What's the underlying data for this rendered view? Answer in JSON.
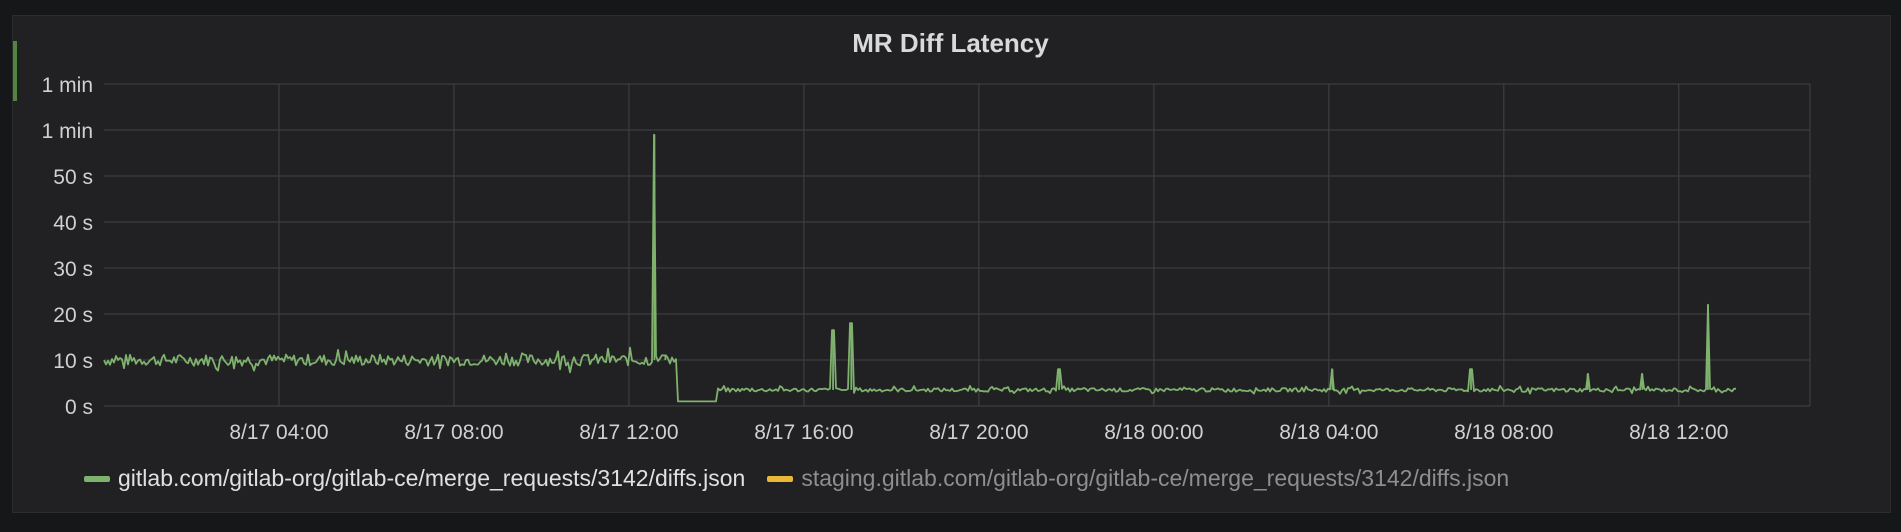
{
  "chart_data": {
    "type": "line",
    "title": "MR Diff Latency",
    "y_unit": "seconds",
    "ylim": [
      0,
      70
    ],
    "yticks": [
      {
        "value": 0,
        "label": "0 s"
      },
      {
        "value": 10,
        "label": "10 s"
      },
      {
        "value": 20,
        "label": "20 s"
      },
      {
        "value": 30,
        "label": "30 s"
      },
      {
        "value": 40,
        "label": "40 s"
      },
      {
        "value": 50,
        "label": "50 s"
      },
      {
        "value": 60,
        "label": "1 min"
      },
      {
        "value": 70,
        "label": "1 min"
      }
    ],
    "xlim": [
      "2016-08-17T00:00",
      "2016-08-18T15:00"
    ],
    "xticks": [
      {
        "value": "2016-08-17T04:00",
        "label": "8/17 04:00"
      },
      {
        "value": "2016-08-17T08:00",
        "label": "8/17 08:00"
      },
      {
        "value": "2016-08-17T12:00",
        "label": "8/17 12:00"
      },
      {
        "value": "2016-08-17T16:00",
        "label": "8/17 16:00"
      },
      {
        "value": "2016-08-17T20:00",
        "label": "8/17 20:00"
      },
      {
        "value": "2016-08-18T00:00",
        "label": "8/18 00:00"
      },
      {
        "value": "2016-08-18T04:00",
        "label": "8/18 04:00"
      },
      {
        "value": "2016-08-18T08:00",
        "label": "8/18 08:00"
      },
      {
        "value": "2016-08-18T12:00",
        "label": "8/18 12:00"
      }
    ],
    "grid": true,
    "legend_position": "bottom",
    "series": [
      {
        "name": "gitlab.com/gitlab-org/gitlab-ce/merge_requests/3142/diffs.json",
        "color": "#7eb26d",
        "baseline_segments": [
          {
            "from": "2016-08-17T00:00",
            "to": "2016-08-17T13:05",
            "value": 10
          },
          {
            "from": "2016-08-17T13:05",
            "to": "2016-08-17T14:00",
            "value": 1
          },
          {
            "from": "2016-08-17T14:00",
            "to": "2016-08-18T13:20",
            "value": 3.5
          }
        ],
        "noise": [
          {
            "from": "2016-08-17T00:00",
            "to": "2016-08-17T13:05",
            "amplitude": 2.5
          },
          {
            "from": "2016-08-17T14:00",
            "to": "2016-08-18T13:20",
            "amplitude": 0.8
          }
        ],
        "points": [
          {
            "x": "2016-08-17T12:35",
            "y": 59
          },
          {
            "x": "2016-08-17T12:50",
            "y": 11
          },
          {
            "x": "2016-08-17T16:40",
            "y": 16.5
          },
          {
            "x": "2016-08-17T17:05",
            "y": 18
          },
          {
            "x": "2016-08-17T21:50",
            "y": 8
          },
          {
            "x": "2016-08-18T04:05",
            "y": 8
          },
          {
            "x": "2016-08-18T07:15",
            "y": 8
          },
          {
            "x": "2016-08-18T09:55",
            "y": 7
          },
          {
            "x": "2016-08-18T11:10",
            "y": 7
          },
          {
            "x": "2016-08-18T12:40",
            "y": 22
          }
        ]
      },
      {
        "name": "staging.gitlab.com/gitlab-org/gitlab-ce/merge_requests/3142/diffs.json",
        "color": "#eab839",
        "points": []
      }
    ]
  }
}
